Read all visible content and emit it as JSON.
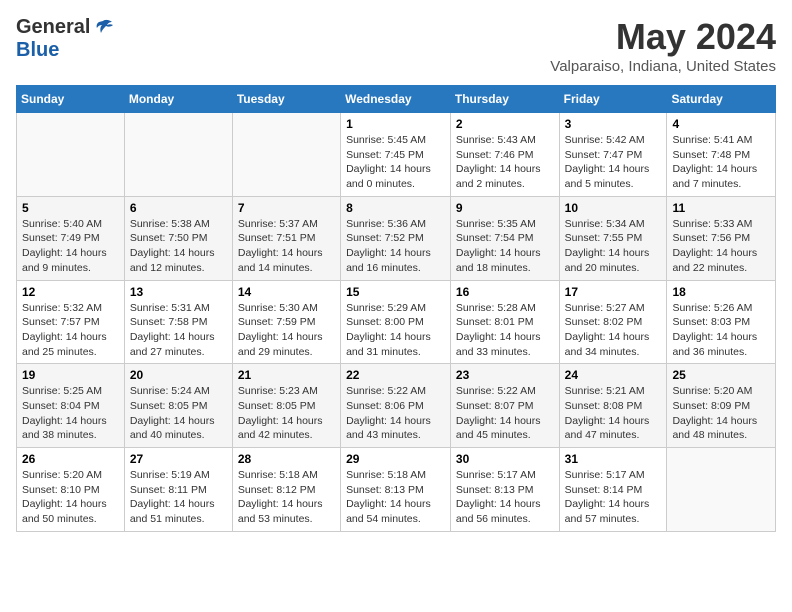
{
  "header": {
    "logo_general": "General",
    "logo_blue": "Blue",
    "month_title": "May 2024",
    "location": "Valparaiso, Indiana, United States"
  },
  "weekdays": [
    "Sunday",
    "Monday",
    "Tuesday",
    "Wednesday",
    "Thursday",
    "Friday",
    "Saturday"
  ],
  "weeks": [
    [
      {
        "day": "",
        "info": ""
      },
      {
        "day": "",
        "info": ""
      },
      {
        "day": "",
        "info": ""
      },
      {
        "day": "1",
        "info": "Sunrise: 5:45 AM\nSunset: 7:45 PM\nDaylight: 14 hours\nand 0 minutes."
      },
      {
        "day": "2",
        "info": "Sunrise: 5:43 AM\nSunset: 7:46 PM\nDaylight: 14 hours\nand 2 minutes."
      },
      {
        "day": "3",
        "info": "Sunrise: 5:42 AM\nSunset: 7:47 PM\nDaylight: 14 hours\nand 5 minutes."
      },
      {
        "day": "4",
        "info": "Sunrise: 5:41 AM\nSunset: 7:48 PM\nDaylight: 14 hours\nand 7 minutes."
      }
    ],
    [
      {
        "day": "5",
        "info": "Sunrise: 5:40 AM\nSunset: 7:49 PM\nDaylight: 14 hours\nand 9 minutes."
      },
      {
        "day": "6",
        "info": "Sunrise: 5:38 AM\nSunset: 7:50 PM\nDaylight: 14 hours\nand 12 minutes."
      },
      {
        "day": "7",
        "info": "Sunrise: 5:37 AM\nSunset: 7:51 PM\nDaylight: 14 hours\nand 14 minutes."
      },
      {
        "day": "8",
        "info": "Sunrise: 5:36 AM\nSunset: 7:52 PM\nDaylight: 14 hours\nand 16 minutes."
      },
      {
        "day": "9",
        "info": "Sunrise: 5:35 AM\nSunset: 7:54 PM\nDaylight: 14 hours\nand 18 minutes."
      },
      {
        "day": "10",
        "info": "Sunrise: 5:34 AM\nSunset: 7:55 PM\nDaylight: 14 hours\nand 20 minutes."
      },
      {
        "day": "11",
        "info": "Sunrise: 5:33 AM\nSunset: 7:56 PM\nDaylight: 14 hours\nand 22 minutes."
      }
    ],
    [
      {
        "day": "12",
        "info": "Sunrise: 5:32 AM\nSunset: 7:57 PM\nDaylight: 14 hours\nand 25 minutes."
      },
      {
        "day": "13",
        "info": "Sunrise: 5:31 AM\nSunset: 7:58 PM\nDaylight: 14 hours\nand 27 minutes."
      },
      {
        "day": "14",
        "info": "Sunrise: 5:30 AM\nSunset: 7:59 PM\nDaylight: 14 hours\nand 29 minutes."
      },
      {
        "day": "15",
        "info": "Sunrise: 5:29 AM\nSunset: 8:00 PM\nDaylight: 14 hours\nand 31 minutes."
      },
      {
        "day": "16",
        "info": "Sunrise: 5:28 AM\nSunset: 8:01 PM\nDaylight: 14 hours\nand 33 minutes."
      },
      {
        "day": "17",
        "info": "Sunrise: 5:27 AM\nSunset: 8:02 PM\nDaylight: 14 hours\nand 34 minutes."
      },
      {
        "day": "18",
        "info": "Sunrise: 5:26 AM\nSunset: 8:03 PM\nDaylight: 14 hours\nand 36 minutes."
      }
    ],
    [
      {
        "day": "19",
        "info": "Sunrise: 5:25 AM\nSunset: 8:04 PM\nDaylight: 14 hours\nand 38 minutes."
      },
      {
        "day": "20",
        "info": "Sunrise: 5:24 AM\nSunset: 8:05 PM\nDaylight: 14 hours\nand 40 minutes."
      },
      {
        "day": "21",
        "info": "Sunrise: 5:23 AM\nSunset: 8:05 PM\nDaylight: 14 hours\nand 42 minutes."
      },
      {
        "day": "22",
        "info": "Sunrise: 5:22 AM\nSunset: 8:06 PM\nDaylight: 14 hours\nand 43 minutes."
      },
      {
        "day": "23",
        "info": "Sunrise: 5:22 AM\nSunset: 8:07 PM\nDaylight: 14 hours\nand 45 minutes."
      },
      {
        "day": "24",
        "info": "Sunrise: 5:21 AM\nSunset: 8:08 PM\nDaylight: 14 hours\nand 47 minutes."
      },
      {
        "day": "25",
        "info": "Sunrise: 5:20 AM\nSunset: 8:09 PM\nDaylight: 14 hours\nand 48 minutes."
      }
    ],
    [
      {
        "day": "26",
        "info": "Sunrise: 5:20 AM\nSunset: 8:10 PM\nDaylight: 14 hours\nand 50 minutes."
      },
      {
        "day": "27",
        "info": "Sunrise: 5:19 AM\nSunset: 8:11 PM\nDaylight: 14 hours\nand 51 minutes."
      },
      {
        "day": "28",
        "info": "Sunrise: 5:18 AM\nSunset: 8:12 PM\nDaylight: 14 hours\nand 53 minutes."
      },
      {
        "day": "29",
        "info": "Sunrise: 5:18 AM\nSunset: 8:13 PM\nDaylight: 14 hours\nand 54 minutes."
      },
      {
        "day": "30",
        "info": "Sunrise: 5:17 AM\nSunset: 8:13 PM\nDaylight: 14 hours\nand 56 minutes."
      },
      {
        "day": "31",
        "info": "Sunrise: 5:17 AM\nSunset: 8:14 PM\nDaylight: 14 hours\nand 57 minutes."
      },
      {
        "day": "",
        "info": ""
      }
    ]
  ]
}
